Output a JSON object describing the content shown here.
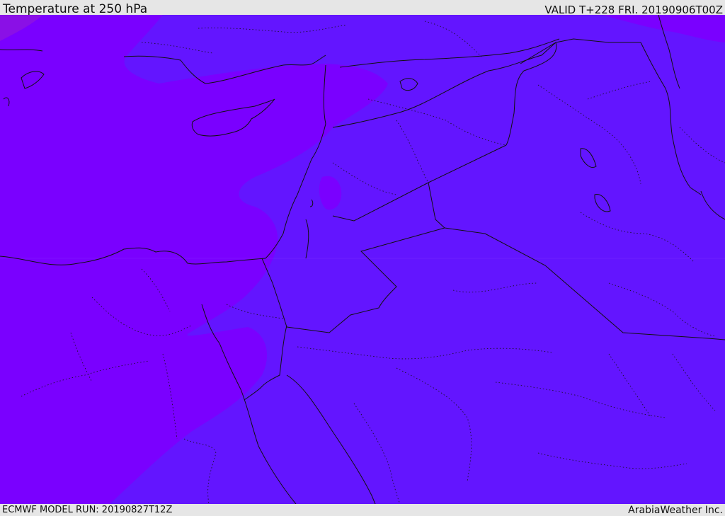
{
  "header": {
    "title": "Temperature at 250 hPa",
    "valid_time": "VALID T+228 FRI. 20190906T00Z"
  },
  "footer": {
    "model_run": "ECMWF MODEL RUN: 20190827T12Z",
    "credit": "ArabiaWeather Inc."
  },
  "map": {
    "colors": {
      "warm_zone": "#7a00ff",
      "cool_zone": "#6315ff",
      "warmest_patch": "#8a10e6",
      "coastline": "#111111",
      "border": "#111111"
    }
  }
}
